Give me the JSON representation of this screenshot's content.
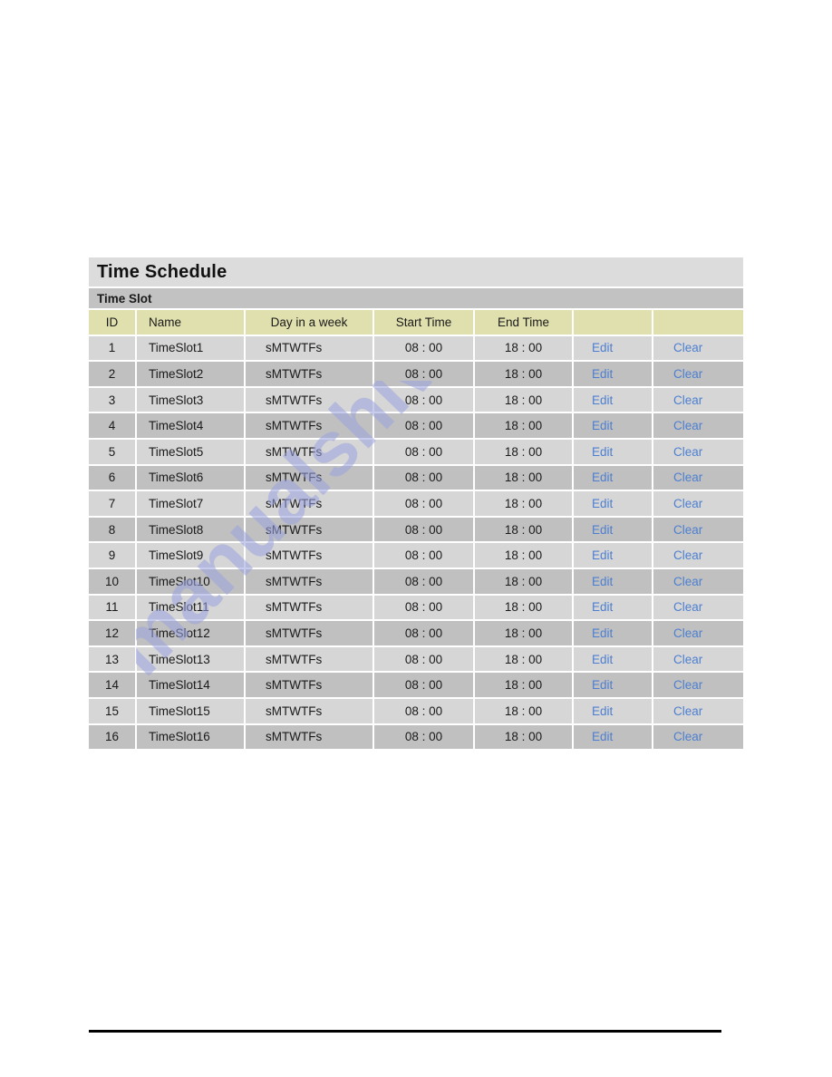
{
  "page": {
    "background_color": "#ffffff",
    "watermark_text": "manualshive.com",
    "watermark_color": "#9ba3e0"
  },
  "panel": {
    "title": "Time Schedule",
    "section_label": "Time Slot",
    "header_bg": "#dcdcdc",
    "section_bg": "#c2c2c2",
    "table_header_bg": "#e0e0ae",
    "row_odd_bg": "#d6d6d6",
    "row_even_bg": "#c0c0c0",
    "link_color": "#4d7fd0"
  },
  "table": {
    "columns": [
      {
        "key": "id",
        "label": "ID"
      },
      {
        "key": "name",
        "label": "Name"
      },
      {
        "key": "day",
        "label": "Day in a week"
      },
      {
        "key": "start",
        "label": "Start Time"
      },
      {
        "key": "end",
        "label": "End Time"
      },
      {
        "key": "edit",
        "label": ""
      },
      {
        "key": "clear",
        "label": ""
      }
    ],
    "edit_label": "Edit",
    "clear_label": "Clear",
    "rows": [
      {
        "id": "1",
        "name": "TimeSlot1",
        "day": "sMTWTFs",
        "start": "08 : 00",
        "end": "18 : 00",
        "edit": "Edit",
        "clear": "Clear"
      },
      {
        "id": "2",
        "name": "TimeSlot2",
        "day": "sMTWTFs",
        "start": "08 : 00",
        "end": "18 : 00",
        "edit": "Edit",
        "clear": "Clear"
      },
      {
        "id": "3",
        "name": "TimeSlot3",
        "day": "sMTWTFs",
        "start": "08 : 00",
        "end": "18 : 00",
        "edit": "Edit",
        "clear": "Clear"
      },
      {
        "id": "4",
        "name": "TimeSlot4",
        "day": "sMTWTFs",
        "start": "08 : 00",
        "end": "18 : 00",
        "edit": "Edit",
        "clear": "Clear"
      },
      {
        "id": "5",
        "name": "TimeSlot5",
        "day": "sMTWTFs",
        "start": "08 : 00",
        "end": "18 : 00",
        "edit": "Edit",
        "clear": "Clear"
      },
      {
        "id": "6",
        "name": "TimeSlot6",
        "day": "sMTWTFs",
        "start": "08 : 00",
        "end": "18 : 00",
        "edit": "Edit",
        "clear": "Clear"
      },
      {
        "id": "7",
        "name": "TimeSlot7",
        "day": "sMTWTFs",
        "start": "08 : 00",
        "end": "18 : 00",
        "edit": "Edit",
        "clear": "Clear"
      },
      {
        "id": "8",
        "name": "TimeSlot8",
        "day": "sMTWTFs",
        "start": "08 : 00",
        "end": "18 : 00",
        "edit": "Edit",
        "clear": "Clear"
      },
      {
        "id": "9",
        "name": "TimeSlot9",
        "day": "sMTWTFs",
        "start": "08 : 00",
        "end": "18 : 00",
        "edit": "Edit",
        "clear": "Clear"
      },
      {
        "id": "10",
        "name": "TimeSlot10",
        "day": "sMTWTFs",
        "start": "08 : 00",
        "end": "18 : 00",
        "edit": "Edit",
        "clear": "Clear"
      },
      {
        "id": "11",
        "name": "TimeSlot11",
        "day": "sMTWTFs",
        "start": "08 : 00",
        "end": "18 : 00",
        "edit": "Edit",
        "clear": "Clear"
      },
      {
        "id": "12",
        "name": "TimeSlot12",
        "day": "sMTWTFs",
        "start": "08 : 00",
        "end": "18 : 00",
        "edit": "Edit",
        "clear": "Clear"
      },
      {
        "id": "13",
        "name": "TimeSlot13",
        "day": "sMTWTFs",
        "start": "08 : 00",
        "end": "18 : 00",
        "edit": "Edit",
        "clear": "Clear"
      },
      {
        "id": "14",
        "name": "TimeSlot14",
        "day": "sMTWTFs",
        "start": "08 : 00",
        "end": "18 : 00",
        "edit": "Edit",
        "clear": "Clear"
      },
      {
        "id": "15",
        "name": "TimeSlot15",
        "day": "sMTWTFs",
        "start": "08 : 00",
        "end": "18 : 00",
        "edit": "Edit",
        "clear": "Clear"
      },
      {
        "id": "16",
        "name": "TimeSlot16",
        "day": "sMTWTFs",
        "start": "08 : 00",
        "end": "18 : 00",
        "edit": "Edit",
        "clear": "Clear"
      }
    ]
  }
}
